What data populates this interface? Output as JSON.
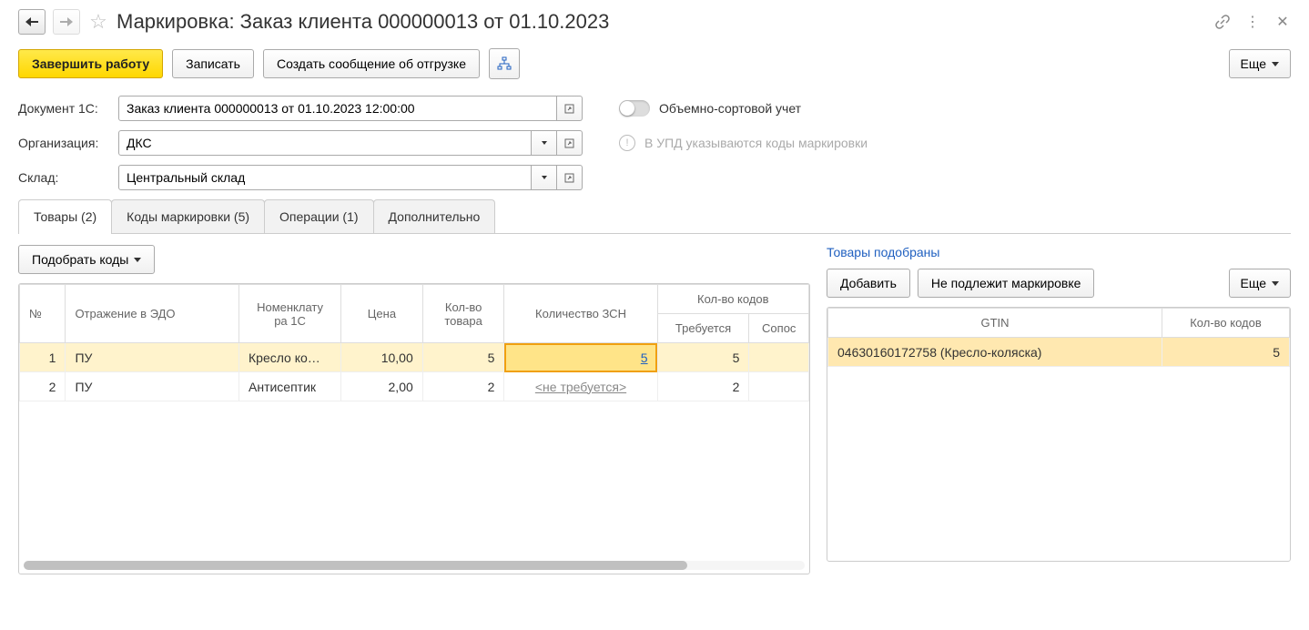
{
  "header": {
    "title": "Маркировка: Заказ клиента 000000013 от 01.10.2023"
  },
  "toolbar": {
    "finish_work": "Завершить работу",
    "save": "Записать",
    "create_shipment_msg": "Создать сообщение об отгрузке",
    "more": "Еще"
  },
  "form": {
    "doc_label": "Документ 1С:",
    "doc_value": "Заказ клиента 000000013 от 01.10.2023 12:00:00",
    "org_label": "Организация:",
    "org_value": "ДКС",
    "warehouse_label": "Склад:",
    "warehouse_value": "Центральный склад",
    "volume_sort_label": "Объемно-сортовой учет",
    "upd_info": "В УПД указываются коды маркировки"
  },
  "tabs": {
    "goods": "Товары (2)",
    "marking_codes": "Коды маркировки (5)",
    "operations": "Операции (1)",
    "additional": "Дополнительно"
  },
  "left": {
    "pick_codes": "Подобрать коды",
    "headers": {
      "num": "№",
      "edo": "Отражение в ЭДО",
      "nomenclature": "Номенклату\nра 1С",
      "price": "Цена",
      "qty_goods": "Кол-во товара",
      "qty_zsn": "Количество ЗСН",
      "qty_codes": "Кол-во кодов",
      "required": "Требуется",
      "matched": "Сопос"
    },
    "rows": [
      {
        "num": "1",
        "edo": "ПУ",
        "nomenclature": "Кресло ко…",
        "price": "10,00",
        "qty": "5",
        "zsn": "5",
        "required": "5",
        "matched": ""
      },
      {
        "num": "2",
        "edo": "ПУ",
        "nomenclature": "Антисептик",
        "price": "2,00",
        "qty": "2",
        "zsn": "<не требуется>",
        "required": "2",
        "matched": ""
      }
    ]
  },
  "right": {
    "status": "Товары подобраны",
    "add": "Добавить",
    "not_subject": "Не подлежит маркировке",
    "more": "Еще",
    "headers": {
      "gtin": "GTIN",
      "qty_codes": "Кол-во кодов"
    },
    "rows": [
      {
        "gtin": "04630160172758 (Кресло-коляска)",
        "qty": "5"
      }
    ]
  }
}
